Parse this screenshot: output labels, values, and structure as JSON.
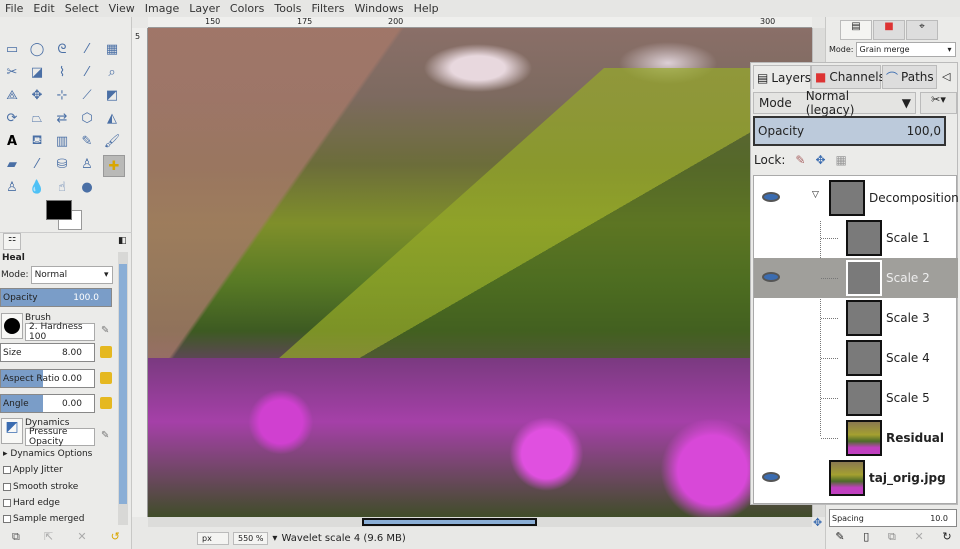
{
  "menu": [
    "File",
    "Edit",
    "Select",
    "View",
    "Image",
    "Layer",
    "Colors",
    "Tools",
    "Filters",
    "Windows",
    "Help"
  ],
  "tools": [
    "rect-select",
    "ellipse-select",
    "free-select",
    "fuzzy-select",
    "color-select",
    "scissors",
    "foreground-select",
    "paths",
    "color-picker",
    "zoom",
    "measure",
    "move",
    "align",
    "crop",
    "unified-transform",
    "rotate",
    "perspective",
    "flip",
    "cage",
    "warp",
    "text",
    "bucket-fill",
    "blend",
    "pencil",
    "paintbrush",
    "eraser",
    "airbrush",
    "ink",
    "clone",
    "heal",
    "perspective-clone",
    "blur",
    "smudge",
    "dodge-burn"
  ],
  "tool_options": {
    "tab_icon": "tool-options",
    "title": "Heal",
    "mode_label": "Mode:",
    "mode_value": "Normal",
    "opacity_label": "Opacity",
    "opacity_value": "100.0",
    "opacity_pct": 100,
    "brush_label": "Brush",
    "brush_value": "2. Hardness 100",
    "size_label": "Size",
    "size_value": "8.00",
    "aspect_label": "Aspect Ratio",
    "aspect_value": "0.00",
    "angle_label": "Angle",
    "angle_value": "0.00",
    "dynamics_label": "Dynamics",
    "dynamics_value": "Pressure Opacity",
    "dynamics_options": "Dynamics Options",
    "checks": [
      "Apply Jitter",
      "Smooth stroke",
      "Hard edge",
      "Sample merged"
    ]
  },
  "ruler": {
    "ticks": [
      "150",
      "175",
      "200",
      "300"
    ],
    "vtick": "5"
  },
  "status": {
    "unit": "px",
    "zoom": "550 %",
    "message": "Wavelet scale 4 (9.6 MB)"
  },
  "right_dock": {
    "mode_label": "Mode:",
    "mode_value": "Grain merge",
    "spacing_label": "Spacing",
    "spacing_value": "10.0"
  },
  "layers": {
    "tabs": [
      "Layers",
      "Channels",
      "Paths"
    ],
    "mode_label": "Mode",
    "mode_value": "Normal (legacy)",
    "opacity_label": "Opacity",
    "opacity_value": "100,0",
    "lock_label": "Lock:",
    "items": [
      {
        "name": "Decomposition",
        "visible": true
      },
      {
        "name": "Scale 1",
        "visible": false
      },
      {
        "name": "Scale 2",
        "visible": true,
        "selected": true
      },
      {
        "name": "Scale 3",
        "visible": false
      },
      {
        "name": "Scale 4",
        "visible": false
      },
      {
        "name": "Scale 5",
        "visible": false
      },
      {
        "name": "Residual",
        "visible": false
      },
      {
        "name": "taj_orig.jpg",
        "visible": true
      }
    ]
  },
  "colors": {
    "accent": "#7a9dc8",
    "selected_row": "#a09f9b"
  }
}
